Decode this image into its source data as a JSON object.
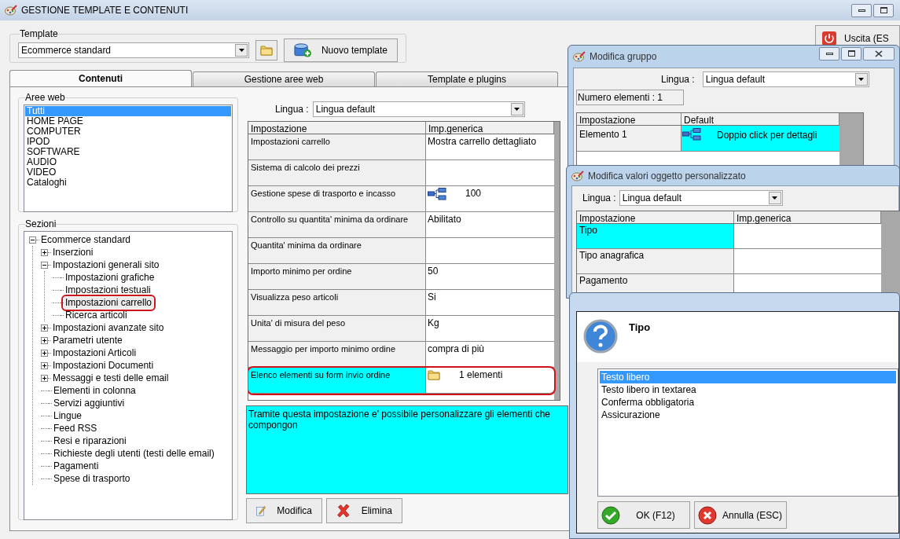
{
  "window": {
    "title": "GESTIONE TEMPLATE E CONTENUTI"
  },
  "template": {
    "label": "Template",
    "value": "Ecommerce standard",
    "new_button": "Nuovo template"
  },
  "exit_button": "Uscita (ES",
  "tabs": [
    {
      "label": "Contenuti",
      "selected": true
    },
    {
      "label": "Gestione aree web",
      "selected": false
    },
    {
      "label": "Template e plugins",
      "selected": false
    }
  ],
  "web_areas": {
    "label": "Aree web",
    "items": [
      {
        "label": "Tutti",
        "selected": true
      },
      {
        "label": "HOME PAGE",
        "selected": false
      },
      {
        "label": "COMPUTER",
        "selected": false
      },
      {
        "label": "IPOD",
        "selected": false
      },
      {
        "label": "SOFTWARE",
        "selected": false
      },
      {
        "label": "AUDIO",
        "selected": false
      },
      {
        "label": "VIDEO",
        "selected": false
      },
      {
        "label": "Cataloghi",
        "selected": false
      }
    ]
  },
  "sections": {
    "label": "Sezioni",
    "tree": [
      {
        "label": "Ecommerce standard",
        "kind": "group",
        "expanded": true,
        "selected": false,
        "annotated": false,
        "children": [
          {
            "label": "Inserzioni",
            "kind": "group",
            "expanded": false,
            "selected": false,
            "annotated": false
          },
          {
            "label": "Impostazioni generali sito",
            "kind": "group",
            "expanded": true,
            "selected": false,
            "annotated": false,
            "children": [
              {
                "label": "Impostazioni grafiche",
                "kind": "leaf",
                "selected": false,
                "annotated": false
              },
              {
                "label": "Impostazioni testuali",
                "kind": "leaf",
                "selected": false,
                "annotated": false
              },
              {
                "label": "Impostazioni carrello",
                "kind": "leaf",
                "selected": true,
                "annotated": true
              },
              {
                "label": "Ricerca articoli",
                "kind": "leaf",
                "selected": false,
                "annotated": false
              }
            ]
          },
          {
            "label": "Impostazioni avanzate sito",
            "kind": "group",
            "expanded": false,
            "selected": false,
            "annotated": false
          },
          {
            "label": "Parametri utente",
            "kind": "group",
            "expanded": false,
            "selected": false,
            "annotated": false
          },
          {
            "label": "Impostazioni Articoli",
            "kind": "group",
            "expanded": false,
            "selected": false,
            "annotated": false
          },
          {
            "label": "Impostazioni Documenti",
            "kind": "group",
            "expanded": false,
            "selected": false,
            "annotated": false
          },
          {
            "label": "Messaggi e testi delle email",
            "kind": "group",
            "expanded": false,
            "selected": false,
            "annotated": false
          },
          {
            "label": "Elementi in colonna",
            "kind": "leaf",
            "selected": false,
            "annotated": false
          },
          {
            "label": "Servizi aggiuntivi",
            "kind": "leaf",
            "selected": false,
            "annotated": false
          },
          {
            "label": "Lingue",
            "kind": "leaf",
            "selected": false,
            "annotated": false
          },
          {
            "label": "Feed RSS",
            "kind": "leaf",
            "selected": false,
            "annotated": false
          },
          {
            "label": "Resi e riparazioni",
            "kind": "leaf",
            "selected": false,
            "annotated": false
          },
          {
            "label": "Richieste degli utenti (testi delle email)",
            "kind": "leaf",
            "selected": false,
            "annotated": false
          },
          {
            "label": "Pagamenti",
            "kind": "leaf",
            "selected": false,
            "annotated": false
          },
          {
            "label": "Spese di trasporto",
            "kind": "leaf",
            "selected": false,
            "annotated": false
          }
        ]
      }
    ]
  },
  "settings": {
    "language_label": "Lingua :",
    "language": "Lingua default",
    "columns": [
      "Impostazione",
      "Imp.generica"
    ],
    "rows": [
      {
        "setting": "Impostazioni carrello",
        "value": "Mostra carrello dettagliato",
        "kind": "text",
        "selected": false,
        "annotated": false
      },
      {
        "setting": "Sistema di calcolo dei prezzi",
        "kind": "text",
        "selected": false,
        "annotated": false
      },
      {
        "setting": "Gestione spese di trasporto e incasso",
        "value": "100",
        "kind": "diagram",
        "selected": false,
        "annotated": false
      },
      {
        "setting": "Controllo su quantita' minima da ordinare",
        "value": "Abilitato",
        "kind": "text",
        "selected": false,
        "annotated": false
      },
      {
        "setting": "Quantita' minima da ordinare",
        "kind": "text",
        "selected": false,
        "annotated": false
      },
      {
        "setting": "Importo minimo per ordine",
        "value": "50",
        "kind": "text",
        "selected": false,
        "annotated": false
      },
      {
        "setting": "Visualizza peso articoli",
        "value": "Si",
        "kind": "text",
        "selected": false,
        "annotated": false
      },
      {
        "setting": "Unita' di misura del peso",
        "value": "Kg",
        "kind": "text",
        "selected": false,
        "annotated": false
      },
      {
        "setting": "Messaggio per importo minimo ordine",
        "value": "compra di più",
        "kind": "text",
        "selected": false,
        "annotated": false
      },
      {
        "setting": "Elenco elementi su form invio ordine",
        "value": "1 elementi",
        "kind": "folder",
        "selected": true,
        "annotated": true
      }
    ],
    "description": "Tramite questa impostazione e' possibile personalizzare gli elementi che compongon",
    "buttons": [
      {
        "label": "Modifica",
        "kind": "edit"
      },
      {
        "label": "Elimina",
        "kind": "delete"
      }
    ]
  },
  "group_dialog": {
    "title": "Modifica gruppo",
    "language_label": "Lingua :",
    "language": "Lingua default",
    "count": "Numero elementi : 1",
    "columns": [
      "Impostazione",
      "Default"
    ],
    "rows": [
      {
        "setting": "Elemento 1",
        "value": "Doppio click per dettagli",
        "selected": true
      }
    ]
  },
  "object_dialog": {
    "title": "Modifica valori oggetto personalizzato",
    "language_label": "Lingua :",
    "language": "Lingua default",
    "columns": [
      "Impostazione",
      "Imp.generica"
    ],
    "rows": [
      {
        "setting": "Tipo",
        "selected": true
      },
      {
        "setting": "Tipo anagrafica",
        "selected": false
      },
      {
        "setting": "Pagamento",
        "selected": false
      }
    ]
  },
  "choice_dialog": {
    "heading": "Tipo",
    "options": [
      {
        "label": "Testo libero",
        "selected": true
      },
      {
        "label": "Testo libero in textarea",
        "selected": false
      },
      {
        "label": "Conferma obbligatoria",
        "selected": false
      },
      {
        "label": "Assicurazione",
        "selected": false
      }
    ],
    "buttons": [
      {
        "label": "OK (F12)",
        "kind": "ok"
      },
      {
        "label": "Annulla (ESC)",
        "kind": "cancel"
      }
    ]
  }
}
